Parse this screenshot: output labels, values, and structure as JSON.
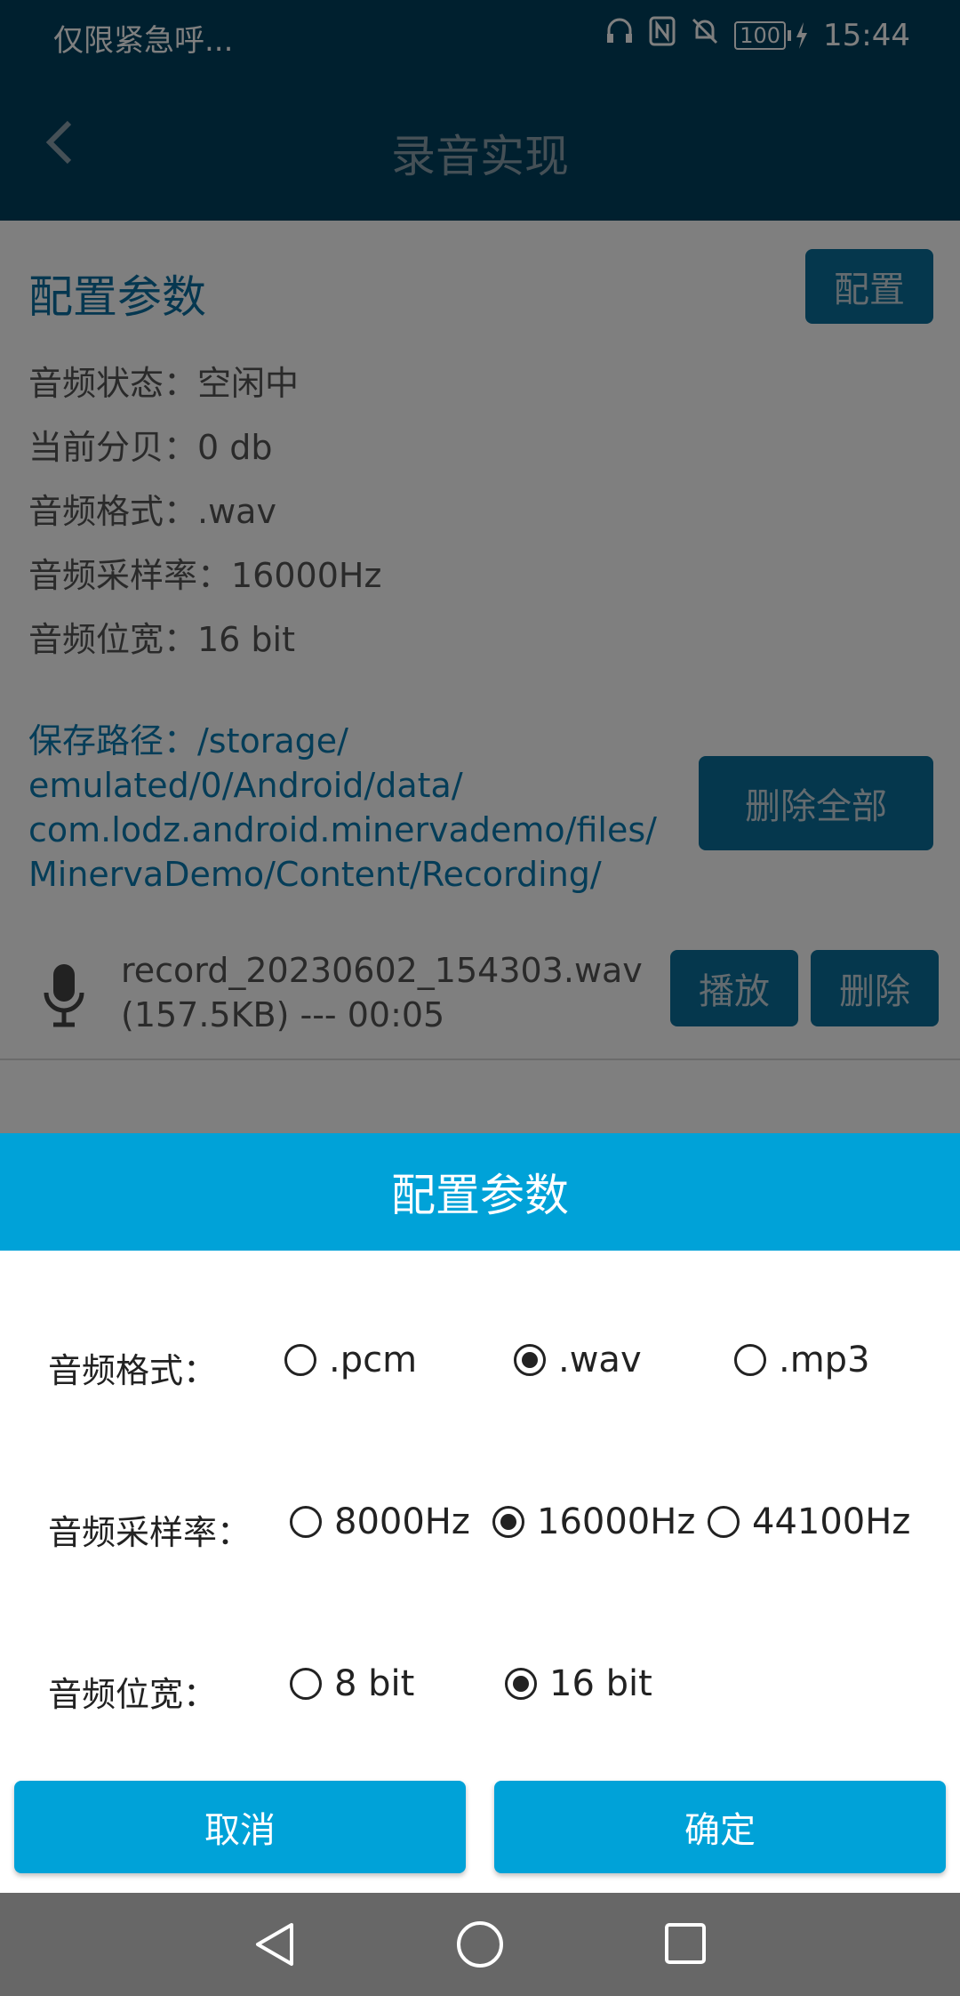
{
  "status": {
    "carrier": "仅限紧急呼...",
    "battery": "100",
    "time": "15:44"
  },
  "appbar": {
    "title": "录音实现"
  },
  "config": {
    "title": "配置参数",
    "button": "配置",
    "lines": [
      "音频状态：空闲中",
      "当前分贝：0 db",
      "音频格式：.wav",
      "音频采样率：16000Hz",
      "音频位宽：16 bit"
    ]
  },
  "storage": {
    "path_lines": [
      "保存路径：/storage/",
      "emulated/0/Android/data/",
      "com.lodz.android.minervademo/files/",
      "MinervaDemo/Content/Recording/"
    ],
    "delete_all": "删除全部"
  },
  "file": {
    "name": "record_20230602_154303.wav",
    "meta": "(157.5KB) --- 00:05",
    "play": "播放",
    "delete": "删除"
  },
  "dialog": {
    "title": "配置参数",
    "rows": [
      {
        "label": "音频格式：",
        "options": [
          ".pcm",
          ".wav",
          ".mp3"
        ],
        "selected": ".wav"
      },
      {
        "label": "音频采样率：",
        "options": [
          "8000Hz",
          "16000Hz",
          "44100Hz"
        ],
        "selected": "16000Hz"
      },
      {
        "label": "音频位宽：",
        "options": [
          "8 bit",
          "16 bit"
        ],
        "selected": "16 bit"
      }
    ],
    "cancel": "取消",
    "confirm": "确定"
  },
  "colors": {
    "appbar": "#00405f",
    "dialog_accent": "#00a2d8",
    "dark_button": "#0a6f9a",
    "navbar": "#676767"
  },
  "icons": [
    "back-icon",
    "mic-icon",
    "nav-back-icon",
    "nav-home-icon",
    "nav-recents-icon"
  ]
}
